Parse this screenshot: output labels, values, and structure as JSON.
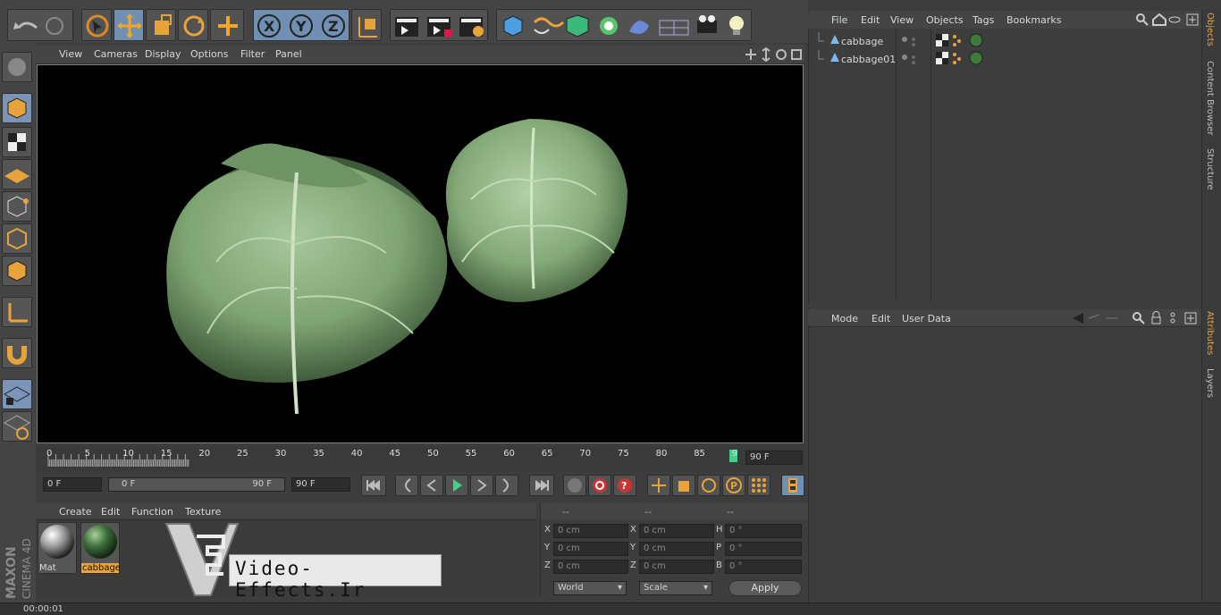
{
  "viewport": {
    "menu": [
      "View",
      "Cameras",
      "Display",
      "Options",
      "Filter",
      "Panel"
    ]
  },
  "timeline": {
    "ticks": [
      "0",
      "5",
      "10",
      "15",
      "20",
      "25",
      "30",
      "35",
      "40",
      "45",
      "50",
      "55",
      "60",
      "65",
      "70",
      "75",
      "80",
      "85",
      "9"
    ],
    "end_frame": "90 F",
    "current_frame": "0 F",
    "range_start": "0 F",
    "range_end": "90 F",
    "max_frame": "90 F"
  },
  "material_manager": {
    "menu": [
      "Create",
      "Edit",
      "Function",
      "Texture"
    ],
    "materials": [
      {
        "name": "Mat",
        "selected": false
      },
      {
        "name": "cabbage",
        "selected": true
      }
    ]
  },
  "coordinates": {
    "headers": [
      "--",
      "--",
      "--"
    ],
    "rows": [
      {
        "axis_a": "X",
        "val_a": "0 cm",
        "axis_b": "X",
        "val_b": "0 cm",
        "axis_c": "H",
        "val_c": "0 °"
      },
      {
        "axis_a": "Y",
        "val_a": "0 cm",
        "axis_b": "Y",
        "val_b": "0 cm",
        "axis_c": "P",
        "val_c": "0 °"
      },
      {
        "axis_a": "Z",
        "val_a": "0 cm",
        "axis_b": "Z",
        "val_b": "0 cm",
        "axis_c": "B",
        "val_c": "0 °"
      }
    ],
    "space": "World",
    "mode": "Scale",
    "apply_label": "Apply"
  },
  "object_manager": {
    "menu": [
      "File",
      "Edit",
      "View",
      "Objects",
      "Tags",
      "Bookmarks"
    ],
    "objects": [
      "cabbage",
      "cabbage01"
    ]
  },
  "attribute_manager": {
    "menu": [
      "Mode",
      "Edit",
      "User Data"
    ]
  },
  "side_tabs": {
    "top": [
      "Objects",
      "Content Browser",
      "Structure"
    ],
    "bottom": [
      "Attributes",
      "Layers"
    ]
  },
  "branding": {
    "logo": "MAXON CINEMA 4D",
    "watermark": "Video-Effects.Ir"
  },
  "status": {
    "time": "00:00:01"
  },
  "colors": {
    "accent_orange": "#e8a33a",
    "active_blue": "#6f8fb3",
    "cabbage_green": "#8fb585"
  }
}
